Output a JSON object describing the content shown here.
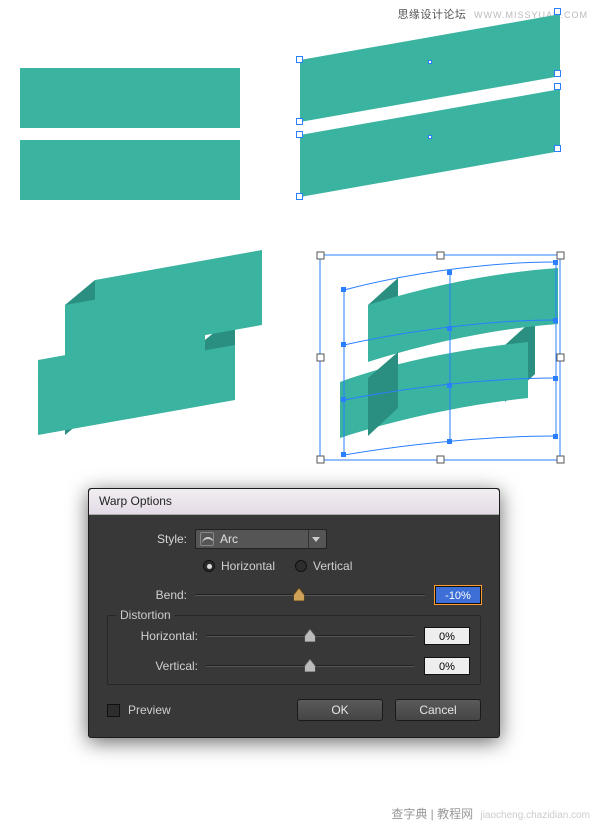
{
  "watermark": {
    "top_cn": "思缘设计论坛",
    "top_url": "WWW.MISSYUAN.COM",
    "bottom_a": "查字典 | 教程网",
    "bottom_b": "jiaocheng.chazidian.com"
  },
  "colors": {
    "teal": "#3bb3a1",
    "teal_dark": "#2a8f80",
    "selection_blue": "#2a7fff",
    "dialog_bg": "#383838",
    "highlight_orange": "#ff9c2b",
    "value_active_bg": "#3d6fd6"
  },
  "dialog": {
    "title": "Warp Options",
    "style_label": "Style:",
    "style_value": "Arc",
    "orientation": {
      "horizontal": "Horizontal",
      "vertical": "Vertical",
      "selected": "horizontal"
    },
    "bend": {
      "label": "Bend:",
      "value": "-10%",
      "pos_pct": 45
    },
    "distortion": {
      "legend": "Distortion",
      "horizontal": {
        "label": "Horizontal:",
        "value": "0%",
        "pos_pct": 50
      },
      "vertical": {
        "label": "Vertical:",
        "value": "0%",
        "pos_pct": 50
      }
    },
    "preview_label": "Preview",
    "preview_checked": false,
    "ok_label": "OK",
    "cancel_label": "Cancel"
  }
}
